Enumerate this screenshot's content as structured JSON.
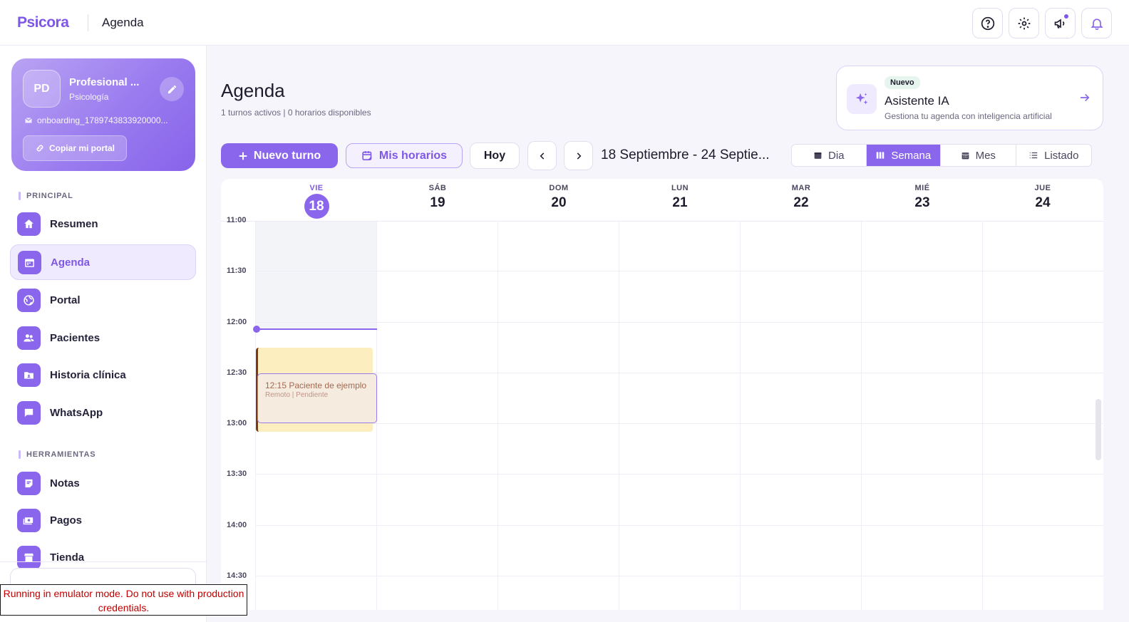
{
  "topbar": {
    "brand": "Psicora",
    "title": "Agenda",
    "icons": [
      "help-icon",
      "gear-icon",
      "megaphone-icon",
      "bell-icon"
    ]
  },
  "profile": {
    "initials": "PD",
    "name": "Profesional ...",
    "specialty": "Psicología",
    "email": "onboarding_1789743833920000...",
    "copy_label": "Copiar mi portal"
  },
  "sidebar": {
    "section_principal": "PRINCIPAL",
    "section_tools": "HERRAMIENTAS",
    "items": [
      {
        "label": "Resumen",
        "icon": "home-icon"
      },
      {
        "label": "Agenda",
        "icon": "calendar-icon",
        "active": true
      },
      {
        "label": "Portal",
        "icon": "globe-icon"
      },
      {
        "label": "Pacientes",
        "icon": "users-icon"
      },
      {
        "label": "Historia clínica",
        "icon": "folder-icon"
      },
      {
        "label": "WhatsApp",
        "icon": "chat-icon"
      },
      {
        "label": "Notas",
        "icon": "note-icon"
      },
      {
        "label": "Pagos",
        "icon": "payment-icon"
      },
      {
        "label": "Tienda",
        "icon": "store-icon"
      }
    ]
  },
  "emulator_warning": "Running in emulator mode. Do not use with production credentials.",
  "page": {
    "title": "Agenda",
    "subtitle": "1 turnos activos | 0 horarios disponibles"
  },
  "ai_card": {
    "badge": "Nuevo",
    "title": "Asistente IA",
    "description": "Gestiona tu agenda con inteligencia artificial"
  },
  "toolbar": {
    "new_label": "Nuevo turno",
    "schedules_label": "Mis horarios",
    "today_label": "Hoy",
    "date_range": "18 Septiembre - 24 Septie...",
    "views": [
      {
        "label": "Dia",
        "active": false
      },
      {
        "label": "Semana",
        "active": true
      },
      {
        "label": "Mes",
        "active": false
      },
      {
        "label": "Listado",
        "active": false
      }
    ]
  },
  "calendar": {
    "days": [
      {
        "name": "VIE",
        "num": "18",
        "today": true
      },
      {
        "name": "SÁB",
        "num": "19"
      },
      {
        "name": "DOM",
        "num": "20"
      },
      {
        "name": "LUN",
        "num": "21"
      },
      {
        "name": "MAR",
        "num": "22"
      },
      {
        "name": "MIÉ",
        "num": "23"
      },
      {
        "name": "JUE",
        "num": "24"
      }
    ],
    "times": [
      "11:00",
      "11:30",
      "12:00",
      "12:30",
      "13:00",
      "13:30",
      "14:00",
      "14:30"
    ],
    "event": {
      "title": "12:15 Paciente de ejemplo",
      "meta": "Remoto | Pendiente"
    }
  },
  "colors": {
    "accent": "#8a66ec",
    "brand": "#7e57e6",
    "event_bg": "#fdeebf",
    "event_border": "#7b3a12"
  }
}
